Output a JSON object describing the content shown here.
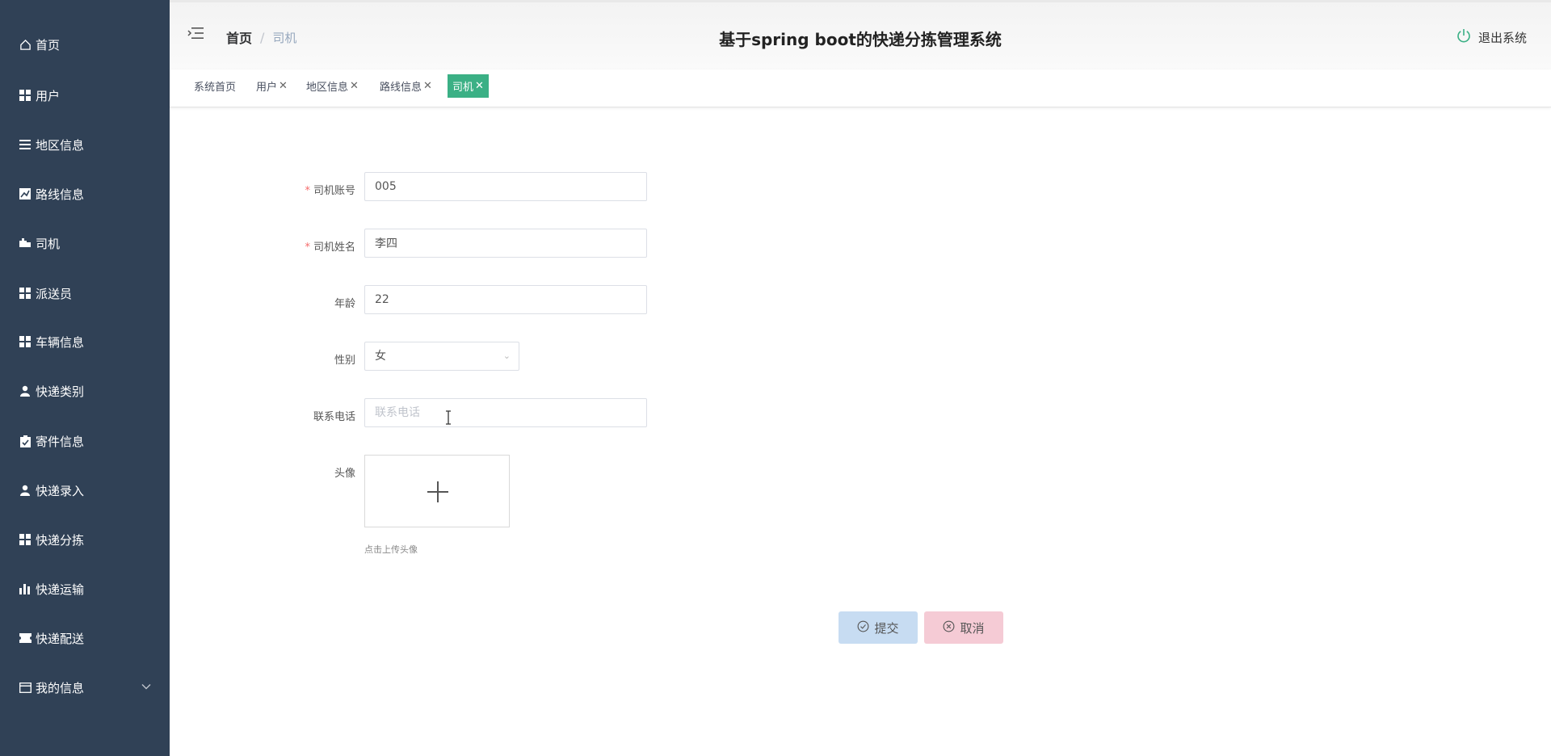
{
  "sidebar": {
    "items": [
      {
        "label": "首页",
        "icon": "home-icon"
      },
      {
        "label": "用户",
        "icon": "grid-icon"
      },
      {
        "label": "地区信息",
        "icon": "list-icon"
      },
      {
        "label": "路线信息",
        "icon": "chart-icon"
      },
      {
        "label": "司机",
        "icon": "truck-icon"
      },
      {
        "label": "派送员",
        "icon": "grid-icon"
      },
      {
        "label": "车辆信息",
        "icon": "grid-icon"
      },
      {
        "label": "快递类别",
        "icon": "user-icon"
      },
      {
        "label": "寄件信息",
        "icon": "clipboard-icon"
      },
      {
        "label": "快递录入",
        "icon": "user-icon"
      },
      {
        "label": "快递分拣",
        "icon": "grid-icon"
      },
      {
        "label": "快递运输",
        "icon": "bar-chart-icon"
      },
      {
        "label": "快递配送",
        "icon": "ticket-icon"
      },
      {
        "label": "我的信息",
        "icon": "card-icon"
      }
    ]
  },
  "header": {
    "breadcrumb_home": "首页",
    "breadcrumb_sep": "/",
    "breadcrumb_current": "司机",
    "title": "基于spring boot的快递分拣管理系统",
    "logout_label": "退出系统"
  },
  "tabs": [
    {
      "label": "系统首页",
      "closable": false
    },
    {
      "label": "用户",
      "closable": true
    },
    {
      "label": "地区信息",
      "closable": true
    },
    {
      "label": "路线信息",
      "closable": true
    },
    {
      "label": "司机",
      "closable": true,
      "active": true
    }
  ],
  "form": {
    "account_label": "司机账号",
    "account_value": "005",
    "name_label": "司机姓名",
    "name_value": "李四",
    "age_label": "年龄",
    "age_value": "22",
    "gender_label": "性别",
    "gender_value": "女",
    "phone_label": "联系电话",
    "phone_value": "",
    "phone_placeholder": "联系电话",
    "avatar_label": "头像",
    "avatar_tip": "点击上传头像",
    "required_mark": "*"
  },
  "buttons": {
    "submit_label": "提交",
    "cancel_label": "取消"
  },
  "colors": {
    "sidebar_bg": "#304156",
    "active_tab": "#3bb085",
    "submit_bg": "#c7dcf2",
    "cancel_bg": "#f5cbd5",
    "required": "#f56c6c"
  }
}
